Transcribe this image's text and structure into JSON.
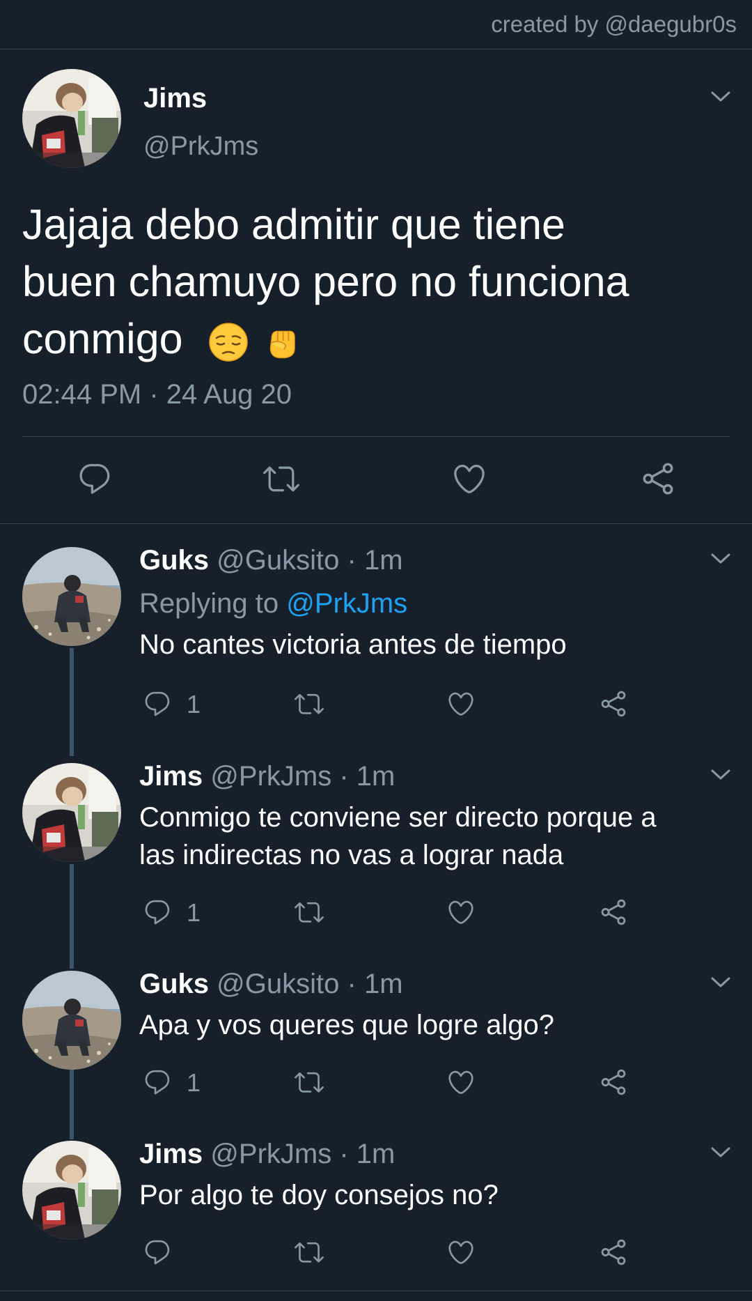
{
  "credit": "created by @daegubr0s",
  "main_tweet": {
    "name": "Jims",
    "handle": "@PrkJms",
    "text_line1": "Jajaja debo admitir que tiene",
    "text_line2": "buen chamuyo pero no funciona",
    "text_line3": "conmigo",
    "emojis": [
      "pensive-face-emoji",
      "raised-fist-emoji"
    ],
    "timestamp": "02:44 PM · 24 Aug 20",
    "actions": [
      "reply-icon",
      "retweet-icon",
      "like-icon",
      "share-icon"
    ]
  },
  "replies": [
    {
      "name": "Guks",
      "handle": "@Guksito",
      "time": "· 1m",
      "replying_prefix": "Replying to",
      "replying_mention": "@PrkJms",
      "text_line1": "No cantes victoria antes de tiempo",
      "text_line2": "",
      "reply_count": "1"
    },
    {
      "name": "Jims",
      "handle": "@PrkJms",
      "time": "· 1m",
      "text_line1": "Conmigo te conviene ser directo porque a",
      "text_line2": "las indirectas no vas a lograr nada",
      "reply_count": "1"
    },
    {
      "name": "Guks",
      "handle": "@Guksito",
      "time": "· 1m",
      "text_line1": "Apa y vos queres que logre algo?",
      "text_line2": "",
      "reply_count": "1"
    },
    {
      "name": "Jims",
      "handle": "@PrkJms",
      "time": "· 1m",
      "text_line1": "Por algo te doy consejos no?",
      "text_line2": "",
      "reply_count": ""
    }
  ],
  "colors": {
    "background": "#15202b",
    "secondary_text": "#8899a6",
    "accent": "#1da1f2",
    "divider": "#38444d",
    "thread_line": "#3d5466"
  }
}
